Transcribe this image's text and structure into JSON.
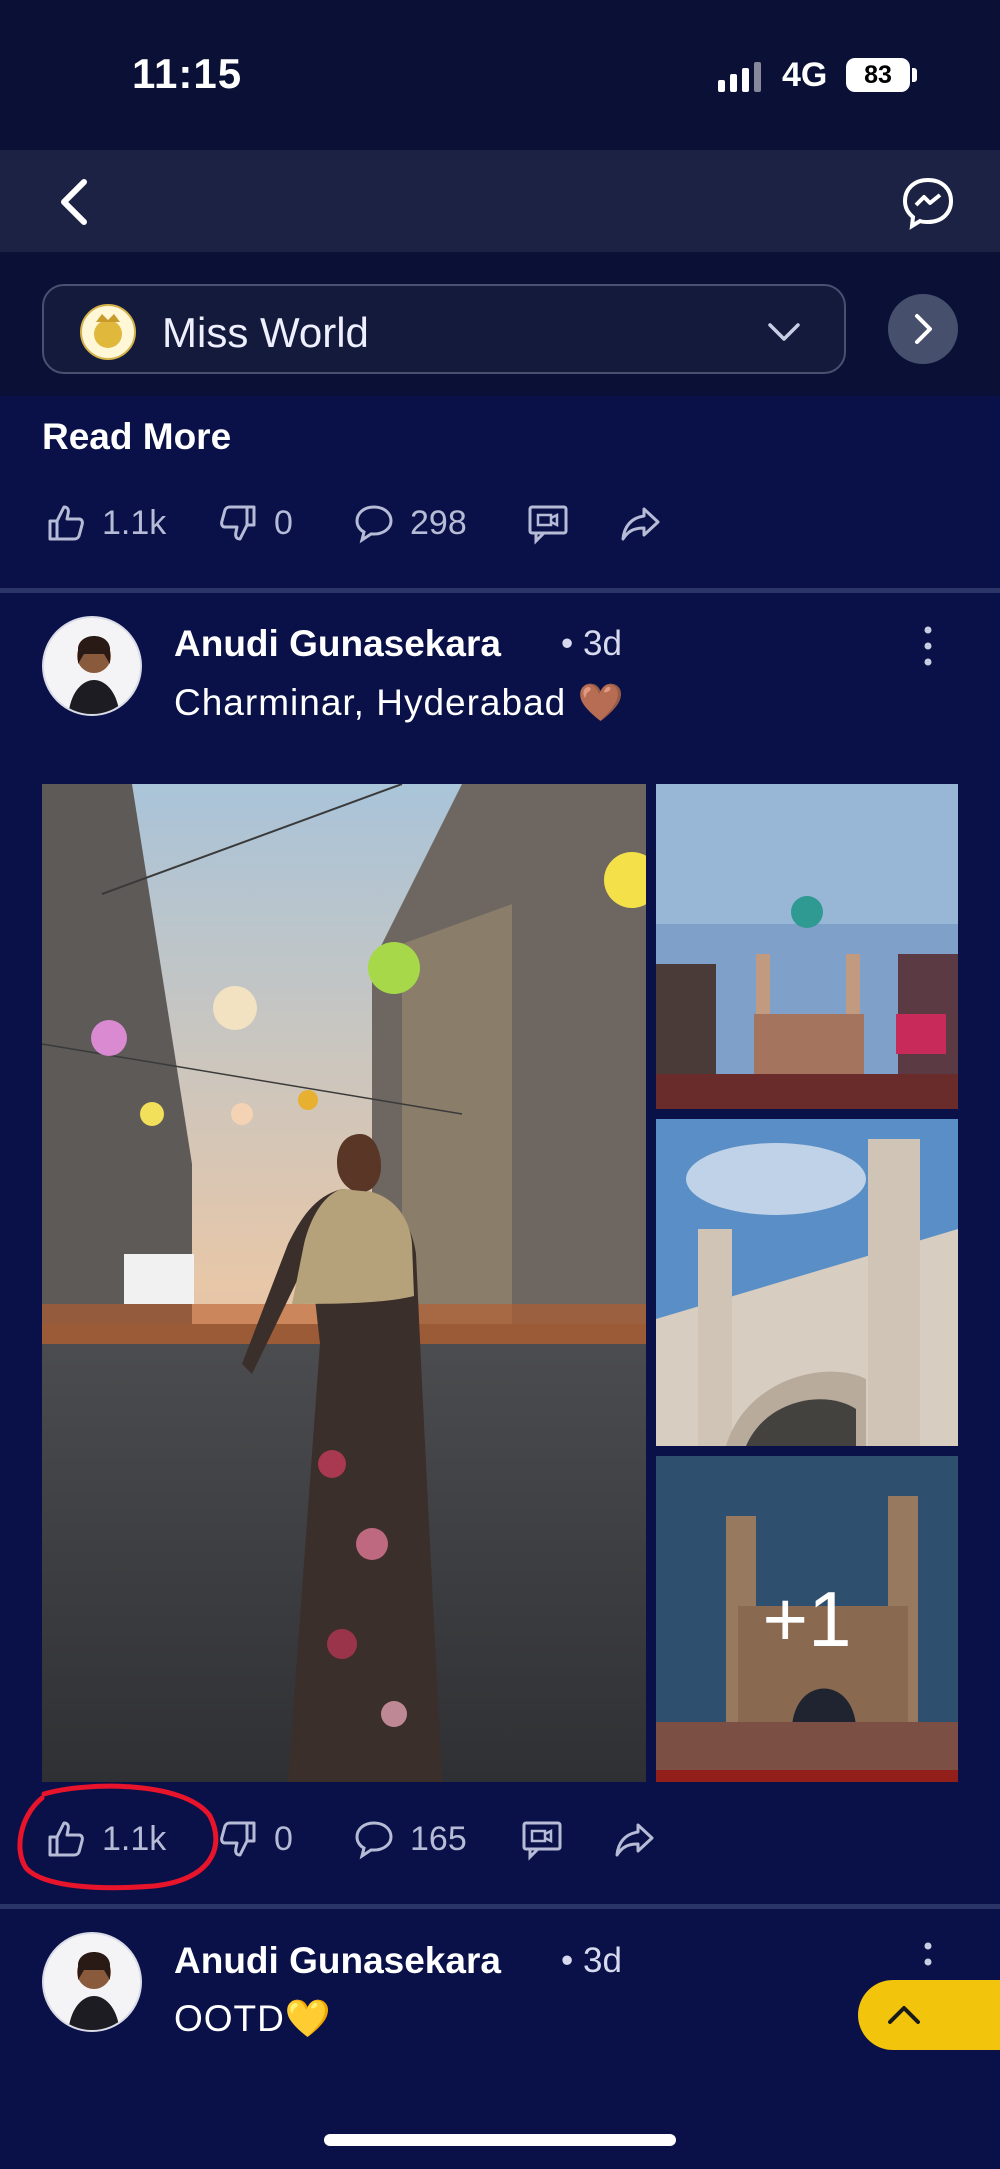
{
  "status": {
    "time": "11:15",
    "network": "4G",
    "battery": "83"
  },
  "community": {
    "name": "Miss World"
  },
  "prev_post": {
    "read_more": "Read More",
    "likes": "1.1k",
    "dislikes": "0",
    "comments": "298"
  },
  "post": {
    "author": "Anudi Gunasekara",
    "time": "3d",
    "text": "Charminar, Hyderabad 🤎",
    "more_images": "+1",
    "likes": "1.1k",
    "dislikes": "0",
    "comments": "165"
  },
  "next_post": {
    "author": "Anudi Gunasekara",
    "time": "3d",
    "text": "OOTD💛"
  },
  "colors": {
    "background": "#0a1148",
    "accent": "#f2c40b",
    "annotation": "#e8142b"
  }
}
